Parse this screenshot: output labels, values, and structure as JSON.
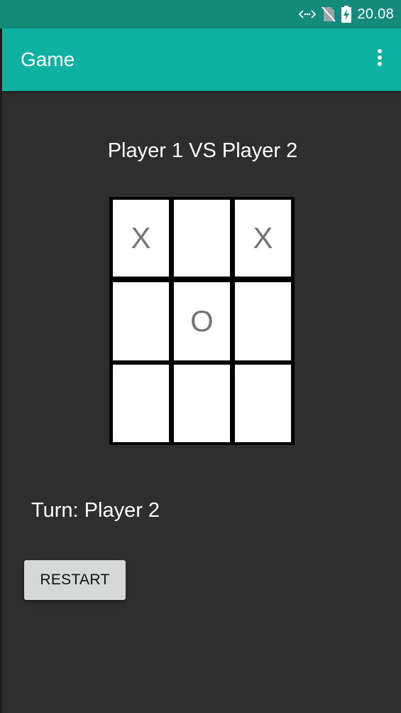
{
  "status_bar": {
    "time": "20.08",
    "icons": [
      "data-sync-icon",
      "no-sim-icon",
      "battery-charging-icon"
    ],
    "color": "#138a7b"
  },
  "app_bar": {
    "title": "Game",
    "color": "#0fb2a2",
    "overflow_icon": "more-vert-icon"
  },
  "main": {
    "match_title": "Player 1 VS Player 2",
    "board": {
      "cells": [
        "X",
        "",
        "X",
        "",
        "O",
        "",
        "",
        "",
        ""
      ]
    },
    "turn_label": "Turn: Player 2",
    "restart_label": "RESTART"
  },
  "colors": {
    "background": "#2e2e2e",
    "board_lines": "#000000",
    "cell_background": "#ffffff",
    "mark_color": "#757575",
    "button_background": "#d6d7d7"
  }
}
